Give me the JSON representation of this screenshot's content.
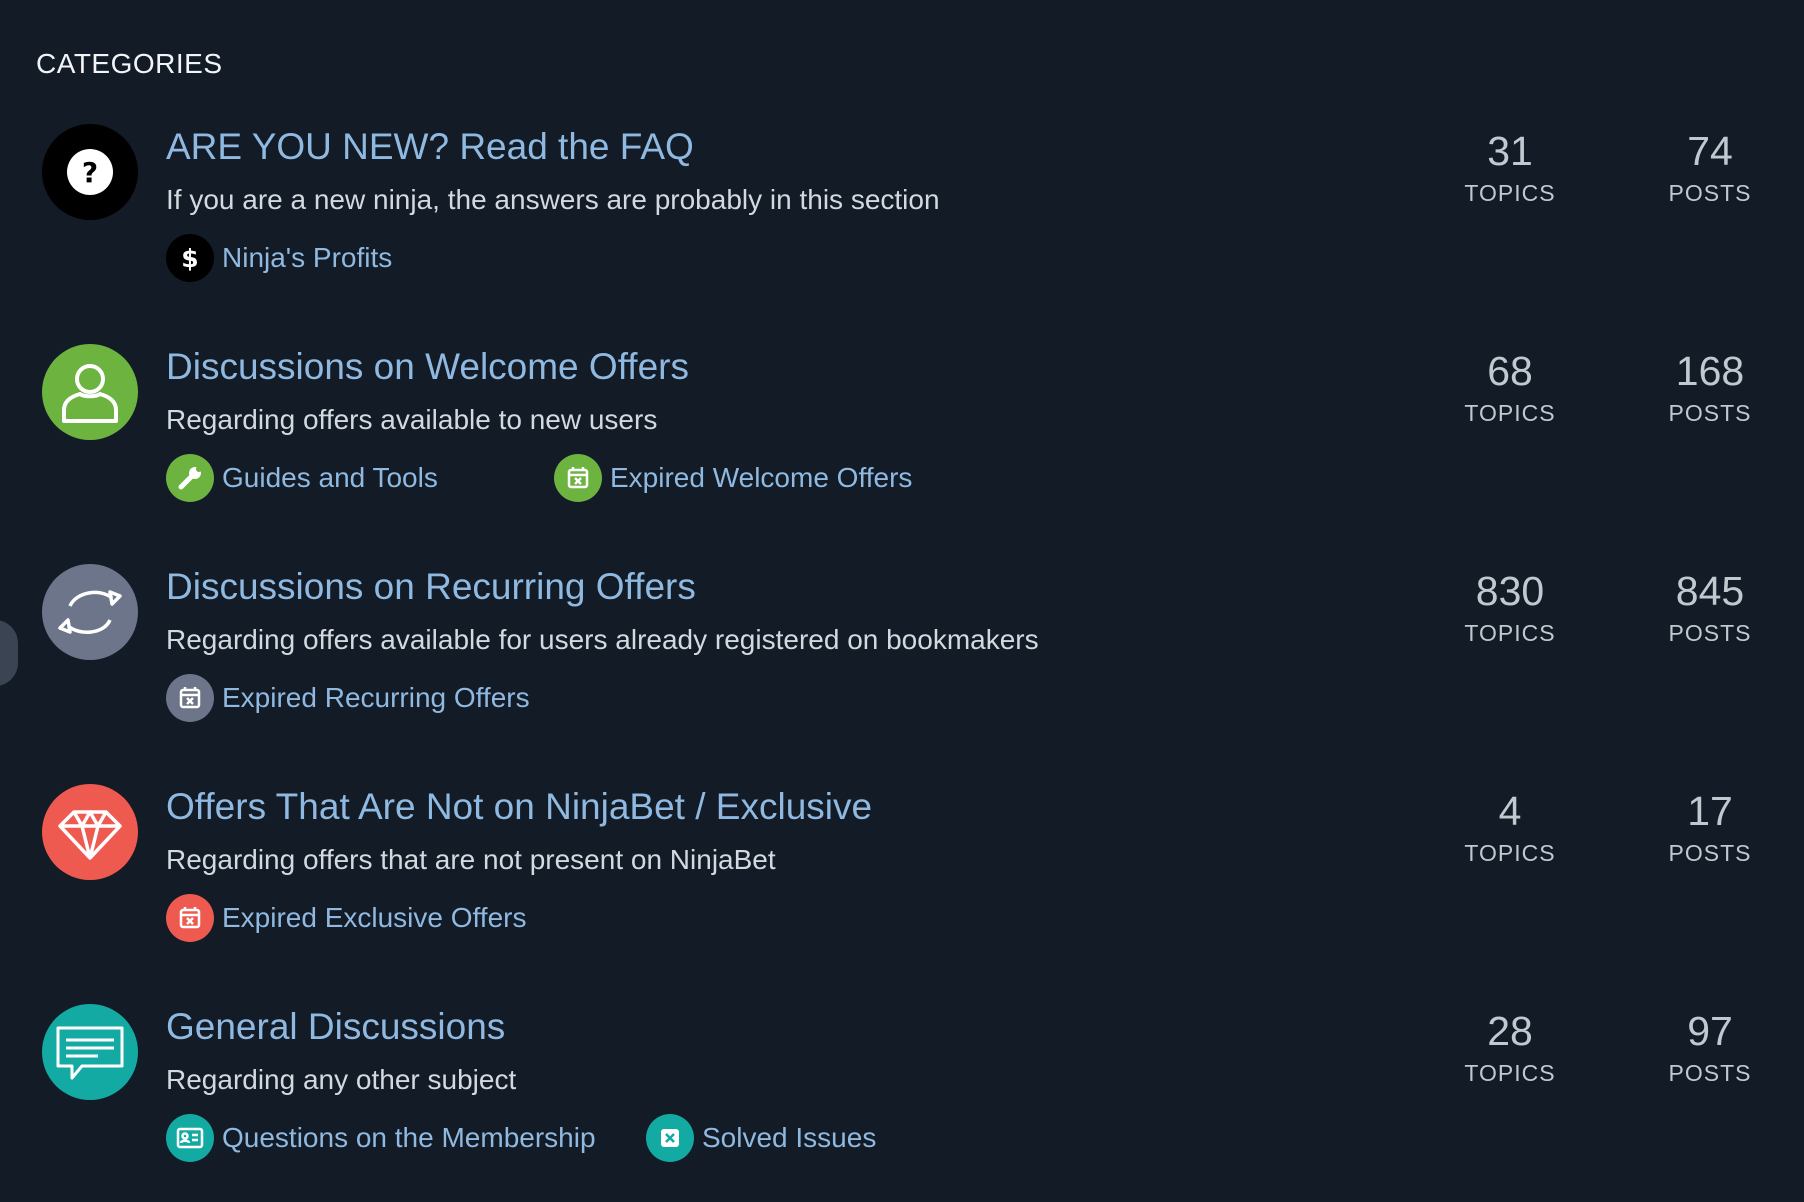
{
  "section_title": "CATEGORIES",
  "categories": [
    {
      "title": "ARE YOU NEW? Read the FAQ",
      "description": "If you are a new ninja, the answers are probably in this section",
      "icon": "question-icon",
      "color": "#000000",
      "topics": "31",
      "posts": "74",
      "topics_label": "TOPICS",
      "posts_label": "POSTS",
      "subcategories": [
        {
          "label": "Ninja's Profits",
          "icon": "dollar-icon",
          "color": "#000000"
        }
      ]
    },
    {
      "title": "Discussions on Welcome Offers",
      "description": "Regarding offers available to new users",
      "icon": "user-icon",
      "color": "#6db33f",
      "topics": "68",
      "posts": "168",
      "topics_label": "TOPICS",
      "posts_label": "POSTS",
      "subcategories": [
        {
          "label": "Guides and Tools",
          "icon": "wrench-icon",
          "color": "#6db33f"
        },
        {
          "label": "Expired Welcome Offers",
          "icon": "calendar-x-icon",
          "color": "#6db33f"
        }
      ]
    },
    {
      "title": "Discussions on Recurring Offers",
      "description": "Regarding offers available for users already registered on bookmakers",
      "icon": "refresh-icon",
      "color": "#6c7589",
      "topics": "830",
      "posts": "845",
      "topics_label": "TOPICS",
      "posts_label": "POSTS",
      "subcategories": [
        {
          "label": "Expired Recurring Offers",
          "icon": "calendar-x-icon",
          "color": "#6c7589"
        }
      ]
    },
    {
      "title": "Offers That Are Not on NinjaBet / Exclusive",
      "description": "Regarding offers that are not present on NinjaBet",
      "icon": "diamond-icon",
      "color": "#ee5a4f",
      "topics": "4",
      "posts": "17",
      "topics_label": "TOPICS",
      "posts_label": "POSTS",
      "subcategories": [
        {
          "label": "Expired Exclusive Offers",
          "icon": "calendar-x-icon",
          "color": "#ee5a4f"
        }
      ]
    },
    {
      "title": "General Discussions",
      "description": "Regarding any other subject",
      "icon": "chat-icon",
      "color": "#14aaa4",
      "topics": "28",
      "posts": "97",
      "topics_label": "TOPICS",
      "posts_label": "POSTS",
      "subcategories": [
        {
          "label": "Questions on the Membership",
          "icon": "id-card-icon",
          "color": "#14aaa4"
        },
        {
          "label": "Solved Issues",
          "icon": "close-square-icon",
          "color": "#14aaa4"
        }
      ]
    }
  ]
}
